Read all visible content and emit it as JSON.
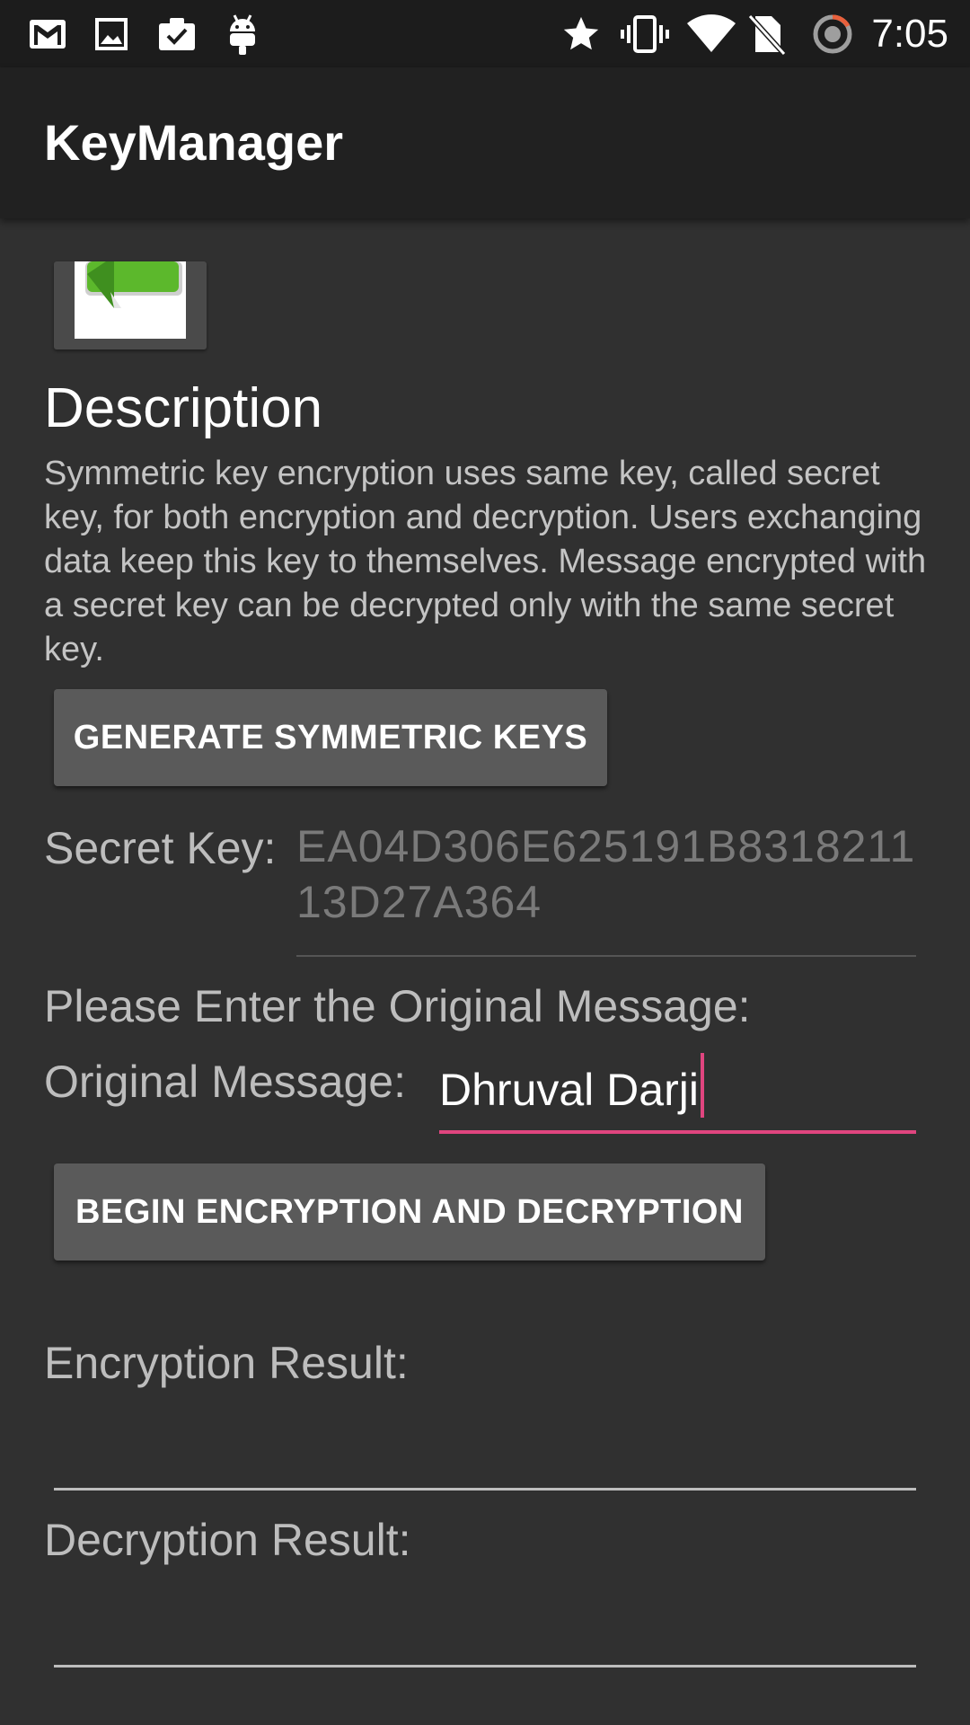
{
  "status_bar": {
    "time": "7:05",
    "icons_left": [
      "gmail-icon",
      "photo-icon",
      "clipboard-check-icon",
      "android-icon"
    ],
    "icons_right": [
      "star-icon",
      "vibrate-icon",
      "wifi-icon",
      "no-sim-icon",
      "sync-icon"
    ]
  },
  "app_bar": {
    "title": "KeyManager"
  },
  "back_button": {
    "icon": "green-back-arrow-icon"
  },
  "description": {
    "heading": "Description",
    "body": "Symmetric key encryption uses same key, called secret key, for both encryption and decryption. Users exchanging data keep this key to themselves. Message encrypted with a secret key can be decrypted only with the same secret key."
  },
  "buttons": {
    "generate": "GENERATE SYMMETRIC KEYS",
    "begin": "BEGIN ENCRYPTION AND DECRYPTION"
  },
  "secret_key": {
    "label": "Secret Key:",
    "value": "EA04D306E625191B831821113D27A364"
  },
  "message": {
    "prompt": "Please Enter the Original Message:",
    "label": "Original Message:",
    "value": "Dhruval Darji"
  },
  "results": {
    "encryption_label": "Encryption Result:",
    "encryption_value": "",
    "decryption_label": "Decryption Result:",
    "decryption_value": ""
  },
  "colors": {
    "background": "#303030",
    "app_bar": "#212121",
    "status_bar": "#1c1c1c",
    "button": "#5a5a5a",
    "accent": "#e0457f",
    "back_arrow": "#5cb82c"
  }
}
